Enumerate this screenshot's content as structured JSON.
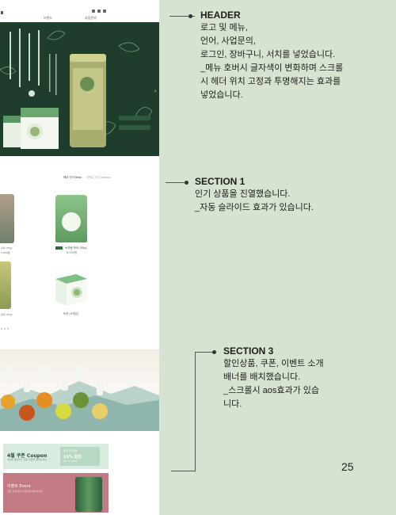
{
  "site": {
    "nav": {
      "menu_a": "브랜드",
      "menu_b": "사업문의"
    },
    "section1": {
      "tab_active": "헤코 인기 Best",
      "tab_other": "이번주 인기 Season",
      "pouch_name": "녹차랑 보리 (50g)",
      "pouch_price": "8,000원",
      "box_name": "녹차 (4개입)",
      "edge_name_1": "홍차 (30g)",
      "edge_price_1": "5,500원",
      "edge_name_2": "보리 (50g)"
    },
    "coupon": {
      "title": "4월 쿠폰 Coupon",
      "subtitle": "4월에 제공하는 각종 쿠폰을 알아보세요",
      "ticket_top": "생일 할인쿠폰",
      "ticket_main": "15% 할인",
      "ticket_bottom": "Apr 2, 2024"
    },
    "event": {
      "title": "이벤트 Event",
      "subtitle": "지금 진행 중인 이벤트를 확인하세요"
    }
  },
  "notes": {
    "header": {
      "title": "HEADER",
      "lines": [
        "로고 및 메뉴,",
        "언어, 사업문의,",
        "로그인, 장바구니, 서치를 넣었습니다.",
        "_메뉴 호버시 글자색이 변화하며 스크롤",
        "시 헤더 위치 고정과 투명해지는 효과를",
        "넣었습니다."
      ]
    },
    "section1": {
      "title": "SECTION 1",
      "lines": [
        "인기 상품을 진열했습니다.",
        "_자동 슬라이드 효과가 있습니다."
      ]
    },
    "section3": {
      "title": "SECTION 3",
      "lines": [
        "할인상품, 쿠폰, 이벤트 소개",
        "배너를 배치했습니다.",
        "_스크롤시 aos효과가 있습",
        "니다."
      ]
    }
  },
  "page_number": "25",
  "colors": {
    "background": "#d7e3d1",
    "hero_green": "#1e3d2c",
    "accent_green": "#2e6d3a",
    "event_pink": "#c37b83"
  }
}
